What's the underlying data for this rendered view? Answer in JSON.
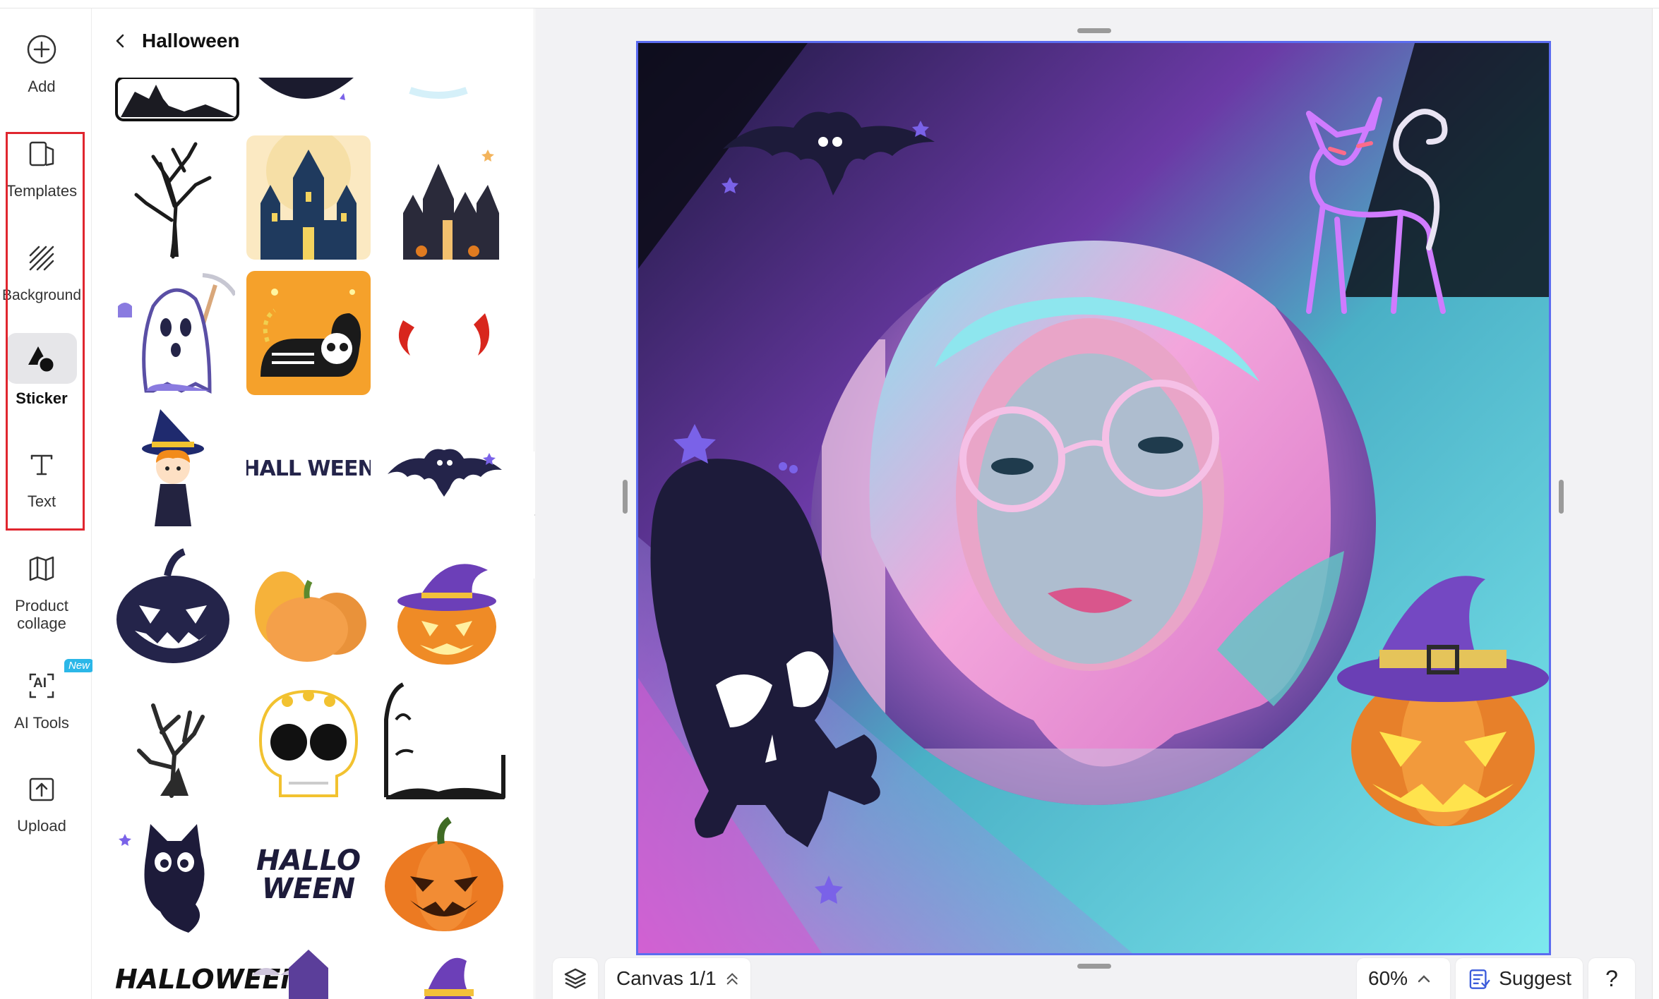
{
  "rail": {
    "items": [
      {
        "label": "Add"
      },
      {
        "label": "Templates"
      },
      {
        "label": "Background"
      },
      {
        "label": "Sticker"
      },
      {
        "label": "Text"
      },
      {
        "label": "Product\ncollage"
      },
      {
        "label": "AI Tools"
      },
      {
        "label": "Upload"
      }
    ],
    "ai_badge": "New",
    "ai_icon_text": "AI"
  },
  "panel": {
    "title": "Halloween"
  },
  "stickers": {
    "text_halloween": "HALL WEEN",
    "text_hallo": "HALLO",
    "text_ween": "WEEN",
    "text_bottom": "HALLOWEEN"
  },
  "bottom_bar": {
    "canvas_label": "Canvas 1/1",
    "zoom": "60%",
    "suggest_label": "Suggest",
    "help_label": "?"
  },
  "colors": {
    "accent": "#5b6cf0",
    "highlight": "#e0262f",
    "badge": "#2bb7e8"
  }
}
